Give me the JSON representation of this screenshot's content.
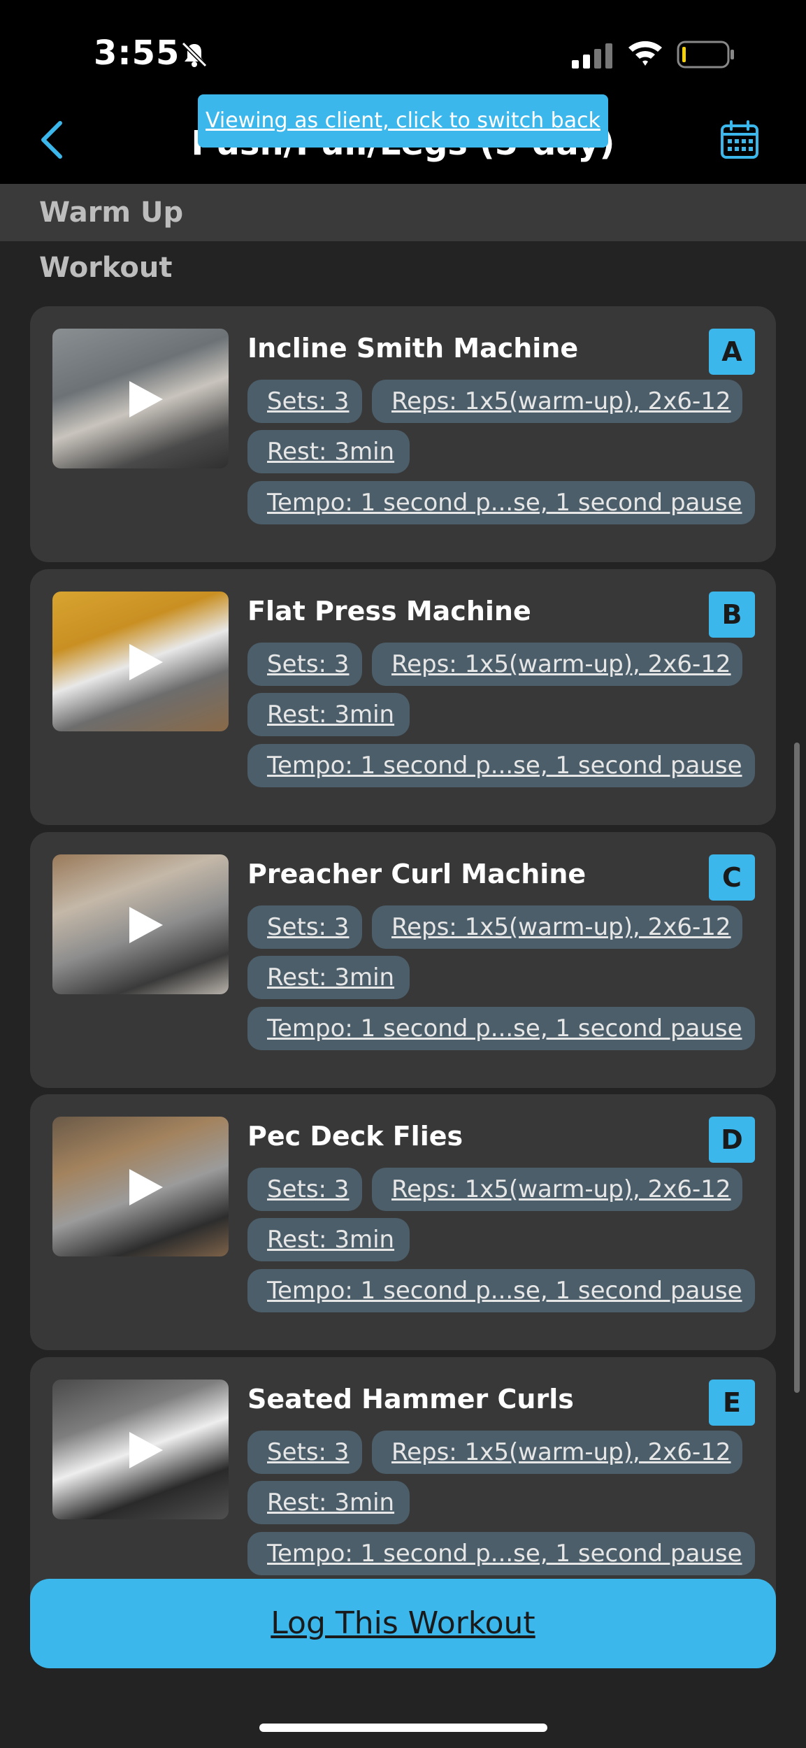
{
  "status_bar": {
    "time": "3:55"
  },
  "header": {
    "title": "Push/Pull/Legs (5-day)",
    "client_banner": "Viewing as client, click to switch back"
  },
  "sections": {
    "warmup": "Warm Up",
    "workout": "Workout"
  },
  "exercises": [
    {
      "name": "Incline Smith Machine",
      "badge": "A",
      "sets": "Sets: 3",
      "reps": "Reps: 1x5(warm-up), 2x6-12",
      "rest": "Rest: 3min",
      "tempo": "Tempo: 1 second p...se, 1 second pause"
    },
    {
      "name": "Flat Press Machine",
      "badge": "B",
      "sets": "Sets: 3",
      "reps": "Reps: 1x5(warm-up), 2x6-12",
      "rest": "Rest: 3min",
      "tempo": "Tempo: 1 second p...se, 1 second pause"
    },
    {
      "name": "Preacher Curl Machine",
      "badge": "C",
      "sets": "Sets: 3",
      "reps": "Reps: 1x5(warm-up), 2x6-12",
      "rest": "Rest: 3min",
      "tempo": "Tempo: 1 second p...se, 1 second pause"
    },
    {
      "name": "Pec Deck Flies",
      "badge": "D",
      "sets": "Sets: 3",
      "reps": "Reps: 1x5(warm-up), 2x6-12",
      "rest": "Rest: 3min",
      "tempo": "Tempo: 1 second p...se, 1 second pause"
    },
    {
      "name": "Seated Hammer Curls",
      "badge": "E",
      "sets": "Sets: 3",
      "reps": "Reps: 1x5(warm-up), 2x6-12",
      "rest": "Rest: 3min",
      "tempo": "Tempo: 1 second p...se, 1 second pause"
    }
  ],
  "log_button": "Log This Workout",
  "colors": {
    "accent": "#3bb7ec",
    "card": "#383838",
    "pill": "#4b5e6a",
    "background": "#232323"
  }
}
